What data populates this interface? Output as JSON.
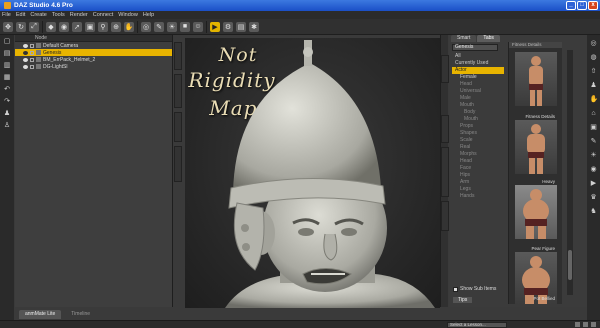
{
  "window": {
    "title": "DAZ Studio 4.6 Pro",
    "btn_min": "_",
    "btn_max": "□",
    "btn_close": "x"
  },
  "menu": [
    "File",
    "Edit",
    "Create",
    "Tools",
    "Render",
    "Connect",
    "Window",
    "Help"
  ],
  "toolbar_icons": [
    "move-icon",
    "rotate-icon",
    "scale-icon",
    "node-icon",
    "camera-icon",
    "select-icon",
    "surface-icon",
    "joint-icon",
    "zoom-icon",
    "pan-icon",
    "spot-render-icon",
    "shader-icon",
    "light-icon",
    "cube-icon",
    "poser-icon",
    "render-icon",
    "render-settings-icon",
    "camera-view-icon",
    "gear-icon"
  ],
  "scene": {
    "header": "Node",
    "rows": [
      {
        "label": "Default Camera",
        "selected": false,
        "indent": 1
      },
      {
        "label": "Genesis",
        "selected": true,
        "indent": 1
      },
      {
        "label": "BM_ErrPack_Helmet_2",
        "selected": false,
        "indent": 1
      },
      {
        "label": "DG-LightSl",
        "selected": false,
        "indent": 1
      }
    ]
  },
  "bottom_tabs": [
    "anmMate Lite",
    "Timeline"
  ],
  "viewport": {
    "line1": "Not",
    "line2": "Rigidity",
    "line3": "Map."
  },
  "library": {
    "tabs": [
      "Smart",
      "Tabs"
    ],
    "dropdown_value": "Genesis",
    "tree": [
      {
        "label": "All",
        "style": ""
      },
      {
        "label": "Currently Used",
        "style": ""
      },
      {
        "label": "Actor",
        "style": "selected"
      },
      {
        "label": "Female",
        "style": "ind"
      },
      {
        "label": "Head",
        "style": "ind dim"
      },
      {
        "label": "Universal",
        "style": "ind dim"
      },
      {
        "label": "Male",
        "style": "ind dim"
      },
      {
        "label": "Mouth",
        "style": "ind dim"
      },
      {
        "label": "Body",
        "style": "ind2 dim"
      },
      {
        "label": "Mouth",
        "style": "ind2 dim"
      },
      {
        "label": "Props",
        "style": "ind dim"
      },
      {
        "label": "Shapes",
        "style": "ind dim"
      },
      {
        "label": "Scale",
        "style": "ind dim"
      },
      {
        "label": "Real",
        "style": "ind dim"
      },
      {
        "label": "Morphs",
        "style": "ind dim"
      },
      {
        "label": "Head",
        "style": "ind dim"
      },
      {
        "label": "Face",
        "style": "ind dim"
      },
      {
        "label": "Hips",
        "style": "ind dim"
      },
      {
        "label": "Arm",
        "style": "ind dim"
      },
      {
        "label": "Legs",
        "style": "ind dim"
      },
      {
        "label": "Hands",
        "style": "ind dim"
      }
    ],
    "show_sub_items": "Show Sub Items",
    "bottom_tab": "Tips",
    "thumb_header": "Fitness Details",
    "thumbs": [
      {
        "label": "Fitness Details",
        "dial": ""
      },
      {
        "label": "Heavy",
        "dial": "1.00"
      },
      {
        "label": "Pear Figure",
        "dial": ""
      },
      {
        "label": "Pot Bellied",
        "dial": ""
      }
    ]
  },
  "status": {
    "lesson": "Select a Lesson..."
  }
}
